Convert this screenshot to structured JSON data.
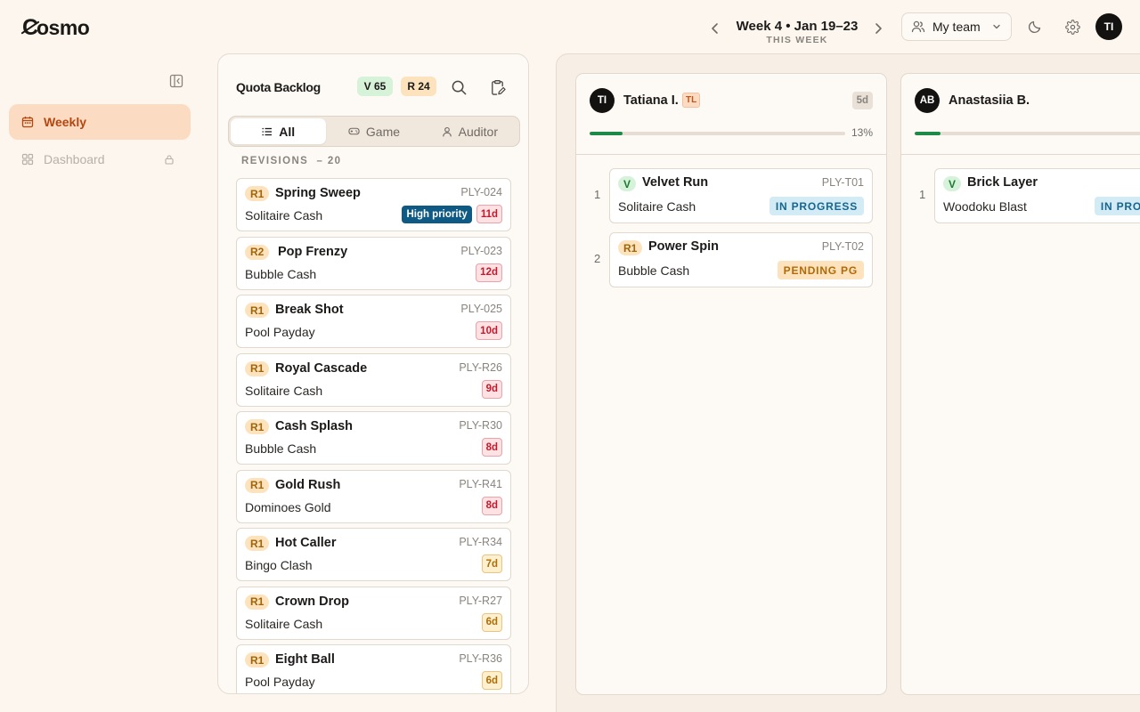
{
  "app": {
    "logo": "osmo",
    "logo_initial": "C"
  },
  "header": {
    "week_title": "Week 4 • Jan 19–23",
    "week_sub": "THIS WEEK",
    "team_label": "My team",
    "user_initials": "TI"
  },
  "sidebar": {
    "items": [
      {
        "label": "Weekly",
        "icon": "calendar-icon",
        "active": true
      },
      {
        "label": "Dashboard",
        "icon": "grid-icon",
        "locked": true
      }
    ]
  },
  "backlog": {
    "title": "Quota Backlog",
    "v_count": "V 65",
    "r_count": "R 24",
    "tabs": [
      {
        "label": "All",
        "icon": "list-icon",
        "active": true
      },
      {
        "label": "Game",
        "icon": "gamepad-icon"
      },
      {
        "label": "Auditor",
        "icon": "user-icon"
      }
    ],
    "section_label": "REVISIONS",
    "section_count": "– 20",
    "cards": [
      {
        "tag": "R1",
        "name": "Spring Sweep",
        "id": "PLY-024",
        "game": "Solitaire Cash",
        "priority": "High priority",
        "age": "11d",
        "age_color": "red"
      },
      {
        "tag": "R2",
        "name": "Pop Frenzy",
        "id": "PLY-023",
        "game": "Bubble Cash",
        "age": "12d",
        "age_color": "red"
      },
      {
        "tag": "R1",
        "name": "Break Shot",
        "id": "PLY-025",
        "game": "Pool Payday",
        "age": "10d",
        "age_color": "red"
      },
      {
        "tag": "R1",
        "name": "Royal Cascade",
        "id": "PLY-R26",
        "game": "Solitaire Cash",
        "age": "9d",
        "age_color": "red"
      },
      {
        "tag": "R1",
        "name": "Cash Splash",
        "id": "PLY-R30",
        "game": "Bubble Cash",
        "age": "8d",
        "age_color": "red"
      },
      {
        "tag": "R1",
        "name": "Gold Rush",
        "id": "PLY-R41",
        "game": "Dominoes Gold",
        "age": "8d",
        "age_color": "red"
      },
      {
        "tag": "R1",
        "name": "Hot Caller",
        "id": "PLY-R34",
        "game": "Bingo Clash",
        "age": "7d",
        "age_color": "amber"
      },
      {
        "tag": "R1",
        "name": "Crown Drop",
        "id": "PLY-R27",
        "game": "Solitaire Cash",
        "age": "6d",
        "age_color": "amber"
      },
      {
        "tag": "R1",
        "name": "Eight Ball",
        "id": "PLY-R36",
        "game": "Pool Payday",
        "age": "6d",
        "age_color": "amber"
      }
    ]
  },
  "board": {
    "columns": [
      {
        "initials": "TI",
        "name": "Tatiana I.",
        "role": "TL",
        "days": "5d",
        "progress": 0.13,
        "progress_label": "13%",
        "tasks": [
          {
            "num": "1",
            "tag": "V",
            "name": "Velvet Run",
            "id": "PLY-T01",
            "game": "Solitaire Cash",
            "status": "IN PROGRESS"
          },
          {
            "num": "2",
            "tag": "R1",
            "name": "Power Spin",
            "id": "PLY-T02",
            "game": "Bubble Cash",
            "status": "PENDING PG"
          }
        ]
      },
      {
        "initials": "AB",
        "name": "Anastasiia B.",
        "progress": 0.1,
        "tasks": [
          {
            "num": "1",
            "tag": "V",
            "name": "Brick Layer",
            "game": "Woodoku Blast",
            "status": "IN PROGRESS"
          }
        ]
      }
    ]
  },
  "colors": {
    "accent": "#b5460f",
    "accent_bg": "#fbdcc3",
    "priority": "#0f5a84",
    "progress": "#1d8a48",
    "in_progress": "#16668f",
    "pending": "#b26a08"
  }
}
